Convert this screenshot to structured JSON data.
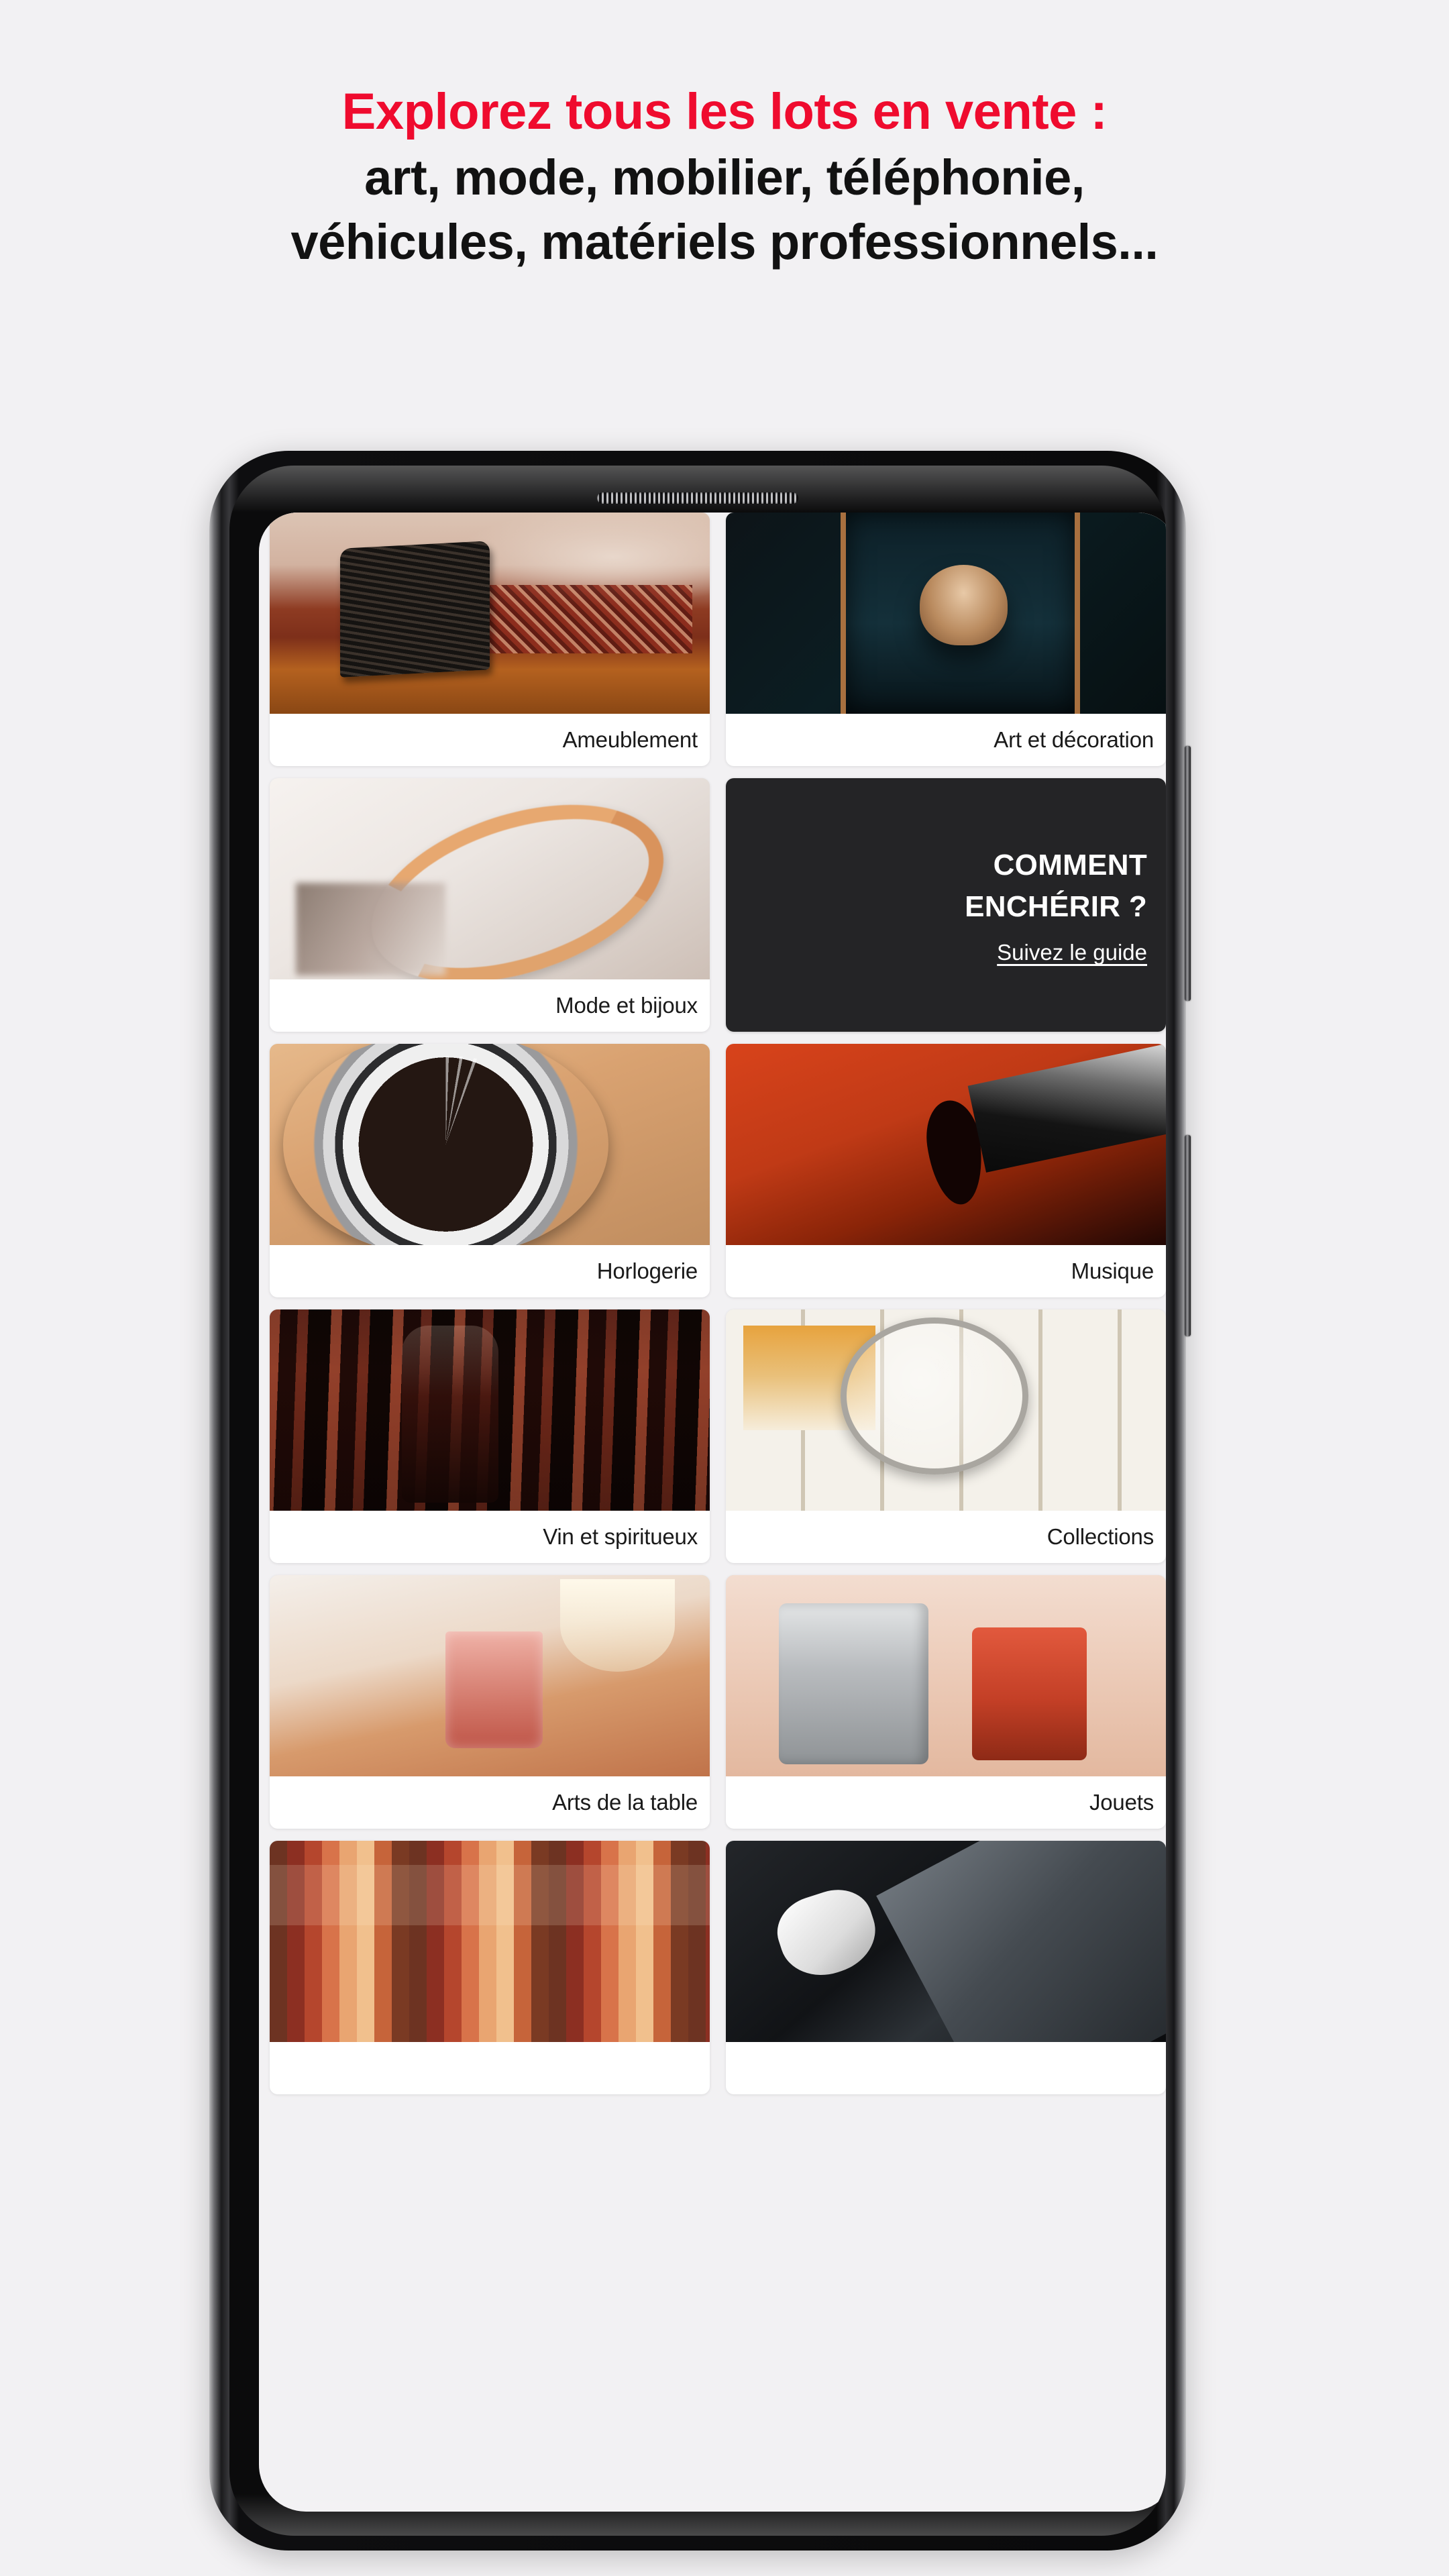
{
  "headline": {
    "line1": "Explorez tous les lots en vente :",
    "line2": "art, mode, mobilier, téléphonie,",
    "line3": "véhicules, matériels professionnels...",
    "accent_color": "#ef0b2e",
    "body_color": "#121212"
  },
  "page": {
    "background_color": "#f2f1f3"
  },
  "phone": {
    "frame_color": "#0a0a0b",
    "speaker_name": "earpiece-speaker-grille",
    "buttons": [
      {
        "name": "power-button"
      },
      {
        "name": "volume-button"
      }
    ]
  },
  "promo_card": {
    "title_line1": "COMMENT",
    "title_line2": "ENCHÉRIR ?",
    "link_label": "Suivez le guide",
    "background_color": "#242426",
    "text_color": "#ffffff"
  },
  "categories": [
    {
      "label": "Ameublement",
      "photo": "armchair-in-warm-room",
      "art_class": "ph-furniture"
    },
    {
      "label": "Art et décoration",
      "photo": "framed-portrait-painting",
      "art_class": "ph-art"
    },
    {
      "label": "Mode et bijoux",
      "photo": "gold-chain-bracelet",
      "art_class": "ph-jewel"
    },
    {
      "label": "Horlogerie",
      "photo": "chronograph-wristwatch",
      "art_class": "ph-watch"
    },
    {
      "label": "Musique",
      "photo": "violin-with-bow",
      "art_class": "ph-violin"
    },
    {
      "label": "Vin et spiritueux",
      "photo": "wine-bottles-on-shelf",
      "art_class": "ph-wine"
    },
    {
      "label": "Collections",
      "photo": "postage-stamps-magnifier",
      "art_class": "ph-stamps"
    },
    {
      "label": "Arts de la table",
      "photo": "glassware-table-setting",
      "art_class": "ph-table"
    },
    {
      "label": "Jouets",
      "photo": "vintage-tin-robots",
      "art_class": "ph-toys"
    },
    {
      "label": "",
      "photo": "vintage-book-spines",
      "art_class": "ph-books"
    },
    {
      "label": "",
      "photo": "tablet-stylus-earbuds",
      "art_class": "ph-tech"
    }
  ]
}
